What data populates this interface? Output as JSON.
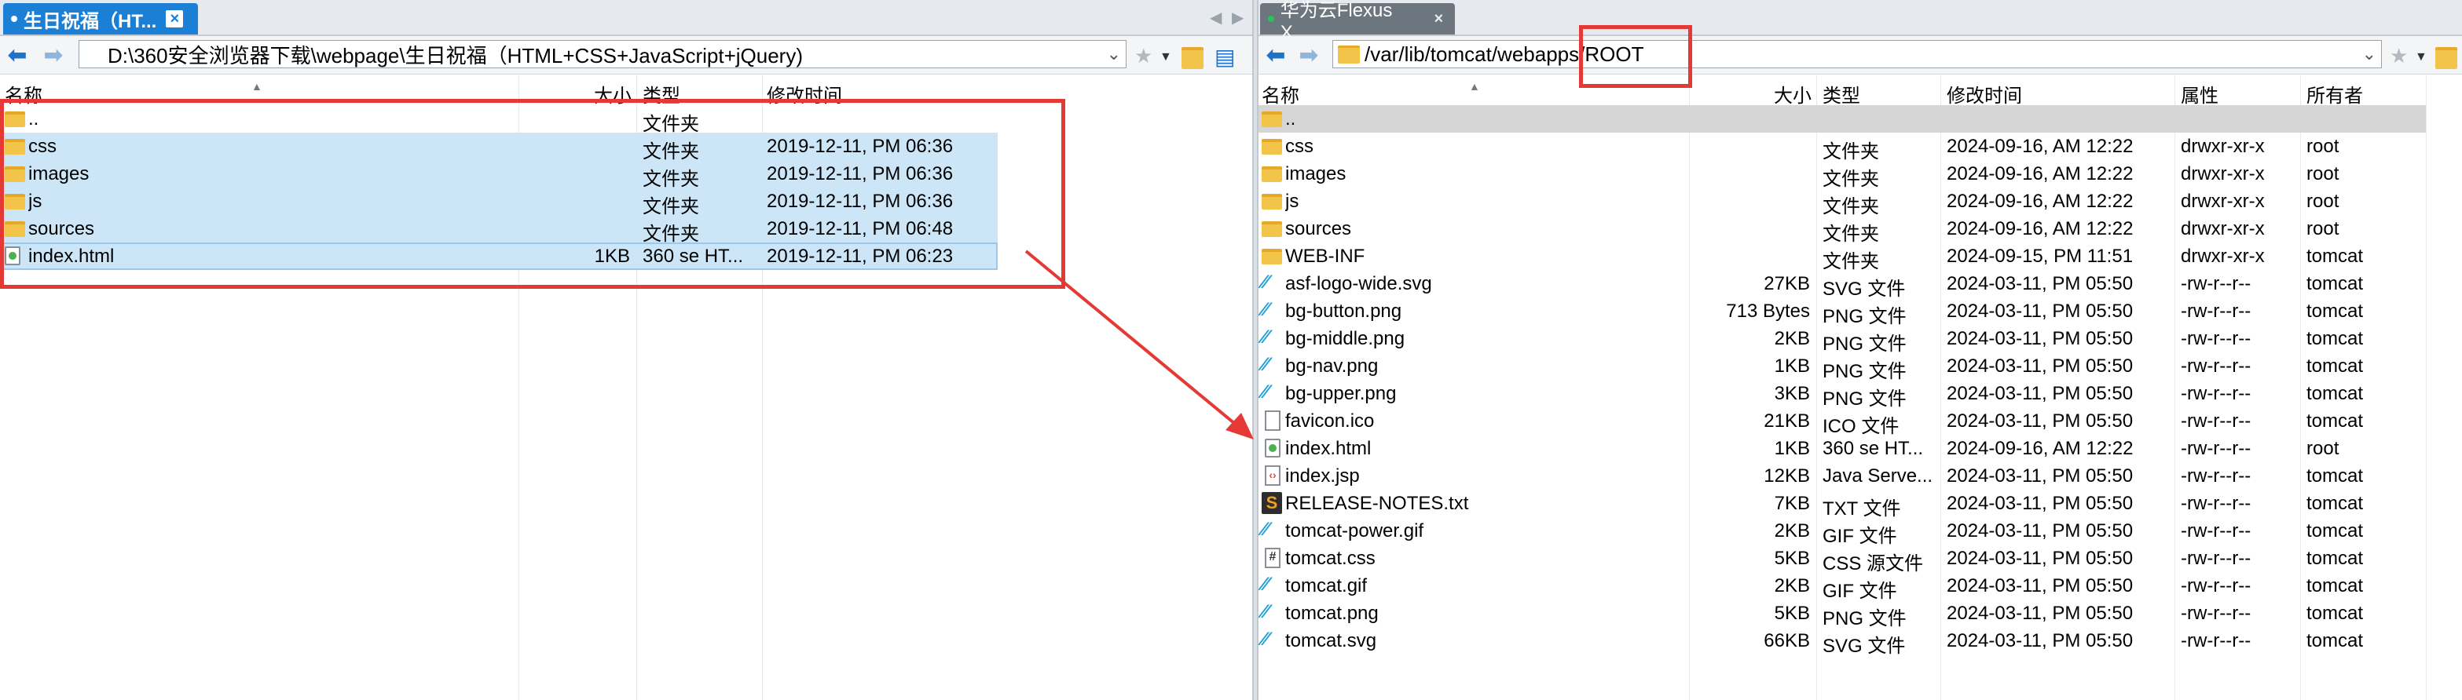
{
  "left": {
    "tab": {
      "title": "生日祝福（HT...",
      "close": "×"
    },
    "address": "D:\\360安全浏览器下载\\webpage\\生日祝福（HTML+CSS+JavaScript+jQuery)",
    "columns": {
      "name": "名称",
      "size": "大小",
      "type": "类型",
      "modified": "修改时间"
    },
    "files": [
      {
        "name": "..",
        "size": "",
        "type": "文件夹",
        "modified": "",
        "icon": "folder-icon"
      },
      {
        "name": "css",
        "size": "",
        "type": "文件夹",
        "modified": "2019-12-11, PM 06:36",
        "icon": "folder-icon"
      },
      {
        "name": "images",
        "size": "",
        "type": "文件夹",
        "modified": "2019-12-11, PM 06:36",
        "icon": "folder-icon"
      },
      {
        "name": "js",
        "size": "",
        "type": "文件夹",
        "modified": "2019-12-11, PM 06:36",
        "icon": "folder-icon"
      },
      {
        "name": "sources",
        "size": "",
        "type": "文件夹",
        "modified": "2019-12-11, PM 06:48",
        "icon": "folder-icon"
      },
      {
        "name": "index.html",
        "size": "1KB",
        "type": "360 se HT...",
        "modified": "2019-12-11, PM 06:23",
        "icon": "html-file-icon"
      }
    ]
  },
  "right": {
    "tab": {
      "title": "华为云Flexus X...",
      "close": "×"
    },
    "address": "/var/lib/tomcat/webapps/ROOT",
    "columns": {
      "name": "名称",
      "size": "大小",
      "type": "类型",
      "modified": "修改时间",
      "perm": "属性",
      "owner": "所有者"
    },
    "files": [
      {
        "name": "..",
        "size": "",
        "type": "",
        "modified": "",
        "perm": "",
        "owner": "",
        "icon": "folder-icon"
      },
      {
        "name": "css",
        "size": "",
        "type": "文件夹",
        "modified": "2024-09-16, AM 12:22",
        "perm": "drwxr-xr-x",
        "owner": "root",
        "icon": "folder-icon"
      },
      {
        "name": "images",
        "size": "",
        "type": "文件夹",
        "modified": "2024-09-16, AM 12:22",
        "perm": "drwxr-xr-x",
        "owner": "root",
        "icon": "folder-icon"
      },
      {
        "name": "js",
        "size": "",
        "type": "文件夹",
        "modified": "2024-09-16, AM 12:22",
        "perm": "drwxr-xr-x",
        "owner": "root",
        "icon": "folder-icon"
      },
      {
        "name": "sources",
        "size": "",
        "type": "文件夹",
        "modified": "2024-09-16, AM 12:22",
        "perm": "drwxr-xr-x",
        "owner": "root",
        "icon": "folder-icon"
      },
      {
        "name": "WEB-INF",
        "size": "",
        "type": "文件夹",
        "modified": "2024-09-15, PM 11:51",
        "perm": "drwxr-xr-x",
        "owner": "tomcat",
        "icon": "folder-icon"
      },
      {
        "name": "asf-logo-wide.svg",
        "size": "27KB",
        "type": "SVG 文件",
        "modified": "2024-03-11, PM 05:50",
        "perm": "-rw-r--r--",
        "owner": "tomcat",
        "icon": "image-file-icon"
      },
      {
        "name": "bg-button.png",
        "size": "713 Bytes",
        "type": "PNG 文件",
        "modified": "2024-03-11, PM 05:50",
        "perm": "-rw-r--r--",
        "owner": "tomcat",
        "icon": "image-file-icon"
      },
      {
        "name": "bg-middle.png",
        "size": "2KB",
        "type": "PNG 文件",
        "modified": "2024-03-11, PM 05:50",
        "perm": "-rw-r--r--",
        "owner": "tomcat",
        "icon": "image-file-icon"
      },
      {
        "name": "bg-nav.png",
        "size": "1KB",
        "type": "PNG 文件",
        "modified": "2024-03-11, PM 05:50",
        "perm": "-rw-r--r--",
        "owner": "tomcat",
        "icon": "image-file-icon"
      },
      {
        "name": "bg-upper.png",
        "size": "3KB",
        "type": "PNG 文件",
        "modified": "2024-03-11, PM 05:50",
        "perm": "-rw-r--r--",
        "owner": "tomcat",
        "icon": "image-file-icon"
      },
      {
        "name": "favicon.ico",
        "size": "21KB",
        "type": "ICO 文件",
        "modified": "2024-03-11, PM 05:50",
        "perm": "-rw-r--r--",
        "owner": "tomcat",
        "icon": "document-file-icon"
      },
      {
        "name": "index.html",
        "size": "1KB",
        "type": "360 se HT...",
        "modified": "2024-09-16, AM 12:22",
        "perm": "-rw-r--r--",
        "owner": "root",
        "icon": "html-file-icon"
      },
      {
        "name": "index.jsp",
        "size": "12KB",
        "type": "Java Serve...",
        "modified": "2024-03-11, PM 05:50",
        "perm": "-rw-r--r--",
        "owner": "tomcat",
        "icon": "jsp-file-icon"
      },
      {
        "name": "RELEASE-NOTES.txt",
        "size": "7KB",
        "type": "TXT 文件",
        "modified": "2024-03-11, PM 05:50",
        "perm": "-rw-r--r--",
        "owner": "tomcat",
        "icon": "text-file-icon"
      },
      {
        "name": "tomcat-power.gif",
        "size": "2KB",
        "type": "GIF 文件",
        "modified": "2024-03-11, PM 05:50",
        "perm": "-rw-r--r--",
        "owner": "tomcat",
        "icon": "image-file-icon"
      },
      {
        "name": "tomcat.css",
        "size": "5KB",
        "type": "CSS 源文件",
        "modified": "2024-03-11, PM 05:50",
        "perm": "-rw-r--r--",
        "owner": "tomcat",
        "icon": "css-file-icon"
      },
      {
        "name": "tomcat.gif",
        "size": "2KB",
        "type": "GIF 文件",
        "modified": "2024-03-11, PM 05:50",
        "perm": "-rw-r--r--",
        "owner": "tomcat",
        "icon": "image-file-icon"
      },
      {
        "name": "tomcat.png",
        "size": "5KB",
        "type": "PNG 文件",
        "modified": "2024-03-11, PM 05:50",
        "perm": "-rw-r--r--",
        "owner": "tomcat",
        "icon": "image-file-icon"
      },
      {
        "name": "tomcat.svg",
        "size": "66KB",
        "type": "SVG 文件",
        "modified": "2024-03-11, PM 05:50",
        "perm": "-rw-r--r--",
        "owner": "tomcat",
        "icon": "image-file-icon"
      }
    ]
  },
  "colors": {
    "accent": "#1b7fd6",
    "selection": "#cde6f7",
    "annotation": "#e53935",
    "folder": "#f3c44a"
  }
}
